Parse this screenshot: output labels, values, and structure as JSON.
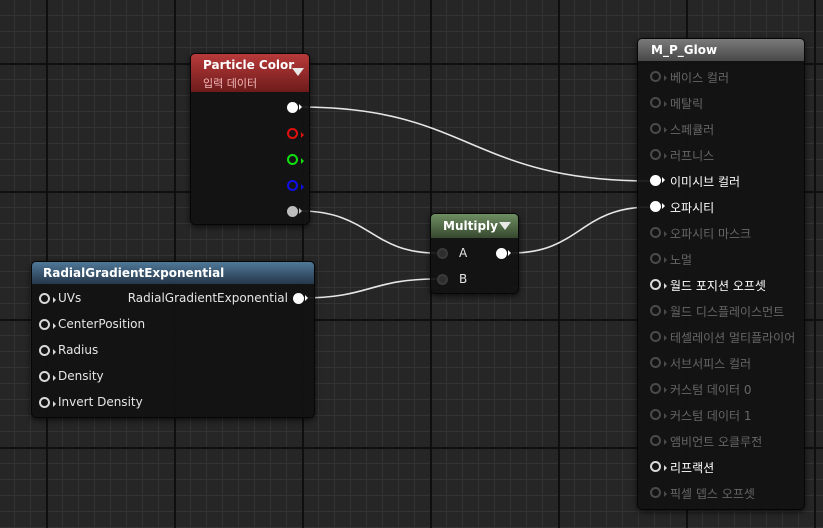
{
  "particle_color": {
    "title": "Particle Color",
    "subtitle": "입력 데이터",
    "pin_colors": [
      "#ffffff",
      "#e01010",
      "#10e010",
      "#1010e8",
      "#bdbdbd"
    ]
  },
  "radial_gradient": {
    "title": "RadialGradientExponential",
    "inputs": [
      "UVs",
      "CenterPosition",
      "Radius",
      "Density",
      "Invert Density"
    ],
    "output": "RadialGradientExponential"
  },
  "multiply": {
    "title": "Multiply",
    "input_a": "A",
    "input_b": "B"
  },
  "material": {
    "title": "M_P_Glow",
    "inputs": [
      {
        "label": "베이스 컬러",
        "active": false,
        "connected": false
      },
      {
        "label": "메탈릭",
        "active": false,
        "connected": false
      },
      {
        "label": "스페큘러",
        "active": false,
        "connected": false
      },
      {
        "label": "러프니스",
        "active": false,
        "connected": false
      },
      {
        "label": "이미시브 컬러",
        "active": true,
        "connected": true
      },
      {
        "label": "오파시티",
        "active": true,
        "connected": true
      },
      {
        "label": "오파시티 마스크",
        "active": false,
        "connected": false
      },
      {
        "label": "노멀",
        "active": false,
        "connected": false
      },
      {
        "label": "월드 포지션 오프셋",
        "active": true,
        "connected": false
      },
      {
        "label": "월드 디스플레이스먼트",
        "active": false,
        "connected": false
      },
      {
        "label": "테셀레이션 멀티플라이어",
        "active": false,
        "connected": false
      },
      {
        "label": "서브서피스 컬러",
        "active": false,
        "connected": false
      },
      {
        "label": "커스텀 데이터 0",
        "active": false,
        "connected": false
      },
      {
        "label": "커스텀 데이터 1",
        "active": false,
        "connected": false
      },
      {
        "label": "앰비언트 오클루전",
        "active": false,
        "connected": false
      },
      {
        "label": "리프랙션",
        "active": true,
        "connected": false
      },
      {
        "label": "픽셀 뎁스 오프셋",
        "active": false,
        "connected": false
      }
    ]
  }
}
